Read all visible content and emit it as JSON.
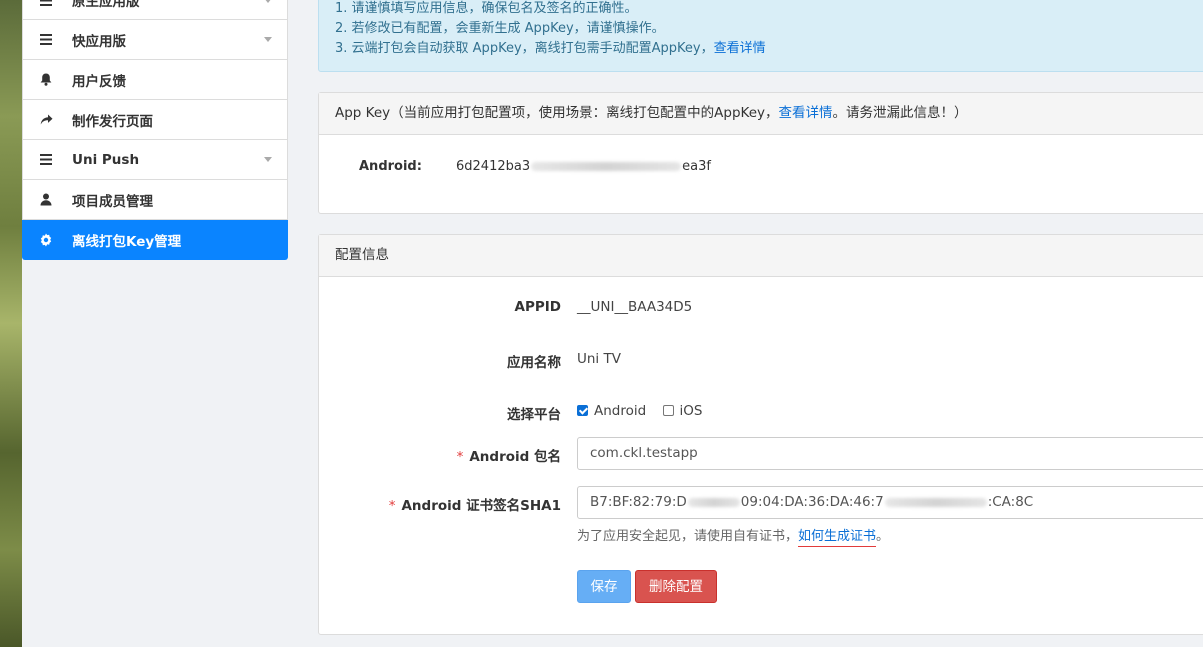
{
  "sidebar": {
    "items": [
      {
        "label": "原生应用版",
        "icon": "list-icon",
        "has_caret": true
      },
      {
        "label": "快应用版",
        "icon": "list-icon",
        "has_caret": true
      },
      {
        "label": "用户反馈",
        "icon": "bell-icon",
        "has_caret": false
      },
      {
        "label": "制作发行页面",
        "icon": "share-arrow-icon",
        "has_caret": false
      },
      {
        "label": "Uni Push",
        "icon": "list-icon",
        "has_caret": true
      },
      {
        "label": "项目成员管理",
        "icon": "user-icon",
        "has_caret": false
      },
      {
        "label": "离线打包Key管理",
        "icon": "gear-icon",
        "has_caret": false,
        "active": true
      }
    ]
  },
  "notice": {
    "line1": "1. 请谨慎填写应用信息，确保包名及签名的正确性。",
    "line2": "2. 若修改已有配置，会重新生成 AppKey，请谨慎操作。",
    "line3_text": "3. 云端打包会自动获取 AppKey，离线打包需手动配置AppKey，",
    "line3_link": "查看详情"
  },
  "appkey_panel": {
    "title_before": "App Key（当前应用打包配置项，使用场景：离线打包配置中的AppKey，",
    "title_link": "查看详情",
    "title_after": "。请务泄漏此信息！）",
    "android_label": "Android:",
    "android_key_start": "6d2412ba3",
    "android_key_end": "ea3f"
  },
  "config_panel": {
    "title": "配置信息",
    "appid_label": "APPID",
    "appid_value": "__UNI__BAA34D5",
    "appname_label": "应用名称",
    "appname_value": "Uni TV",
    "platform_label": "选择平台",
    "platform_android": "Android",
    "platform_ios": "iOS",
    "android_checked": true,
    "ios_checked": false,
    "package_label": "Android 包名",
    "package_value": "com.ckl.testapp",
    "sha1_label": "Android 证书签名SHA1",
    "sha1_value_start": "B7:BF:82:79:D",
    "sha1_value_mid": "09:04:DA:36:DA:46:7",
    "sha1_value_end": ":CA:8C",
    "required_mark": "*",
    "help_text": "为了应用安全起见，请使用自有证书，",
    "help_link": "如何生成证书",
    "help_end": "。",
    "save_label": "保存",
    "delete_label": "删除配置"
  },
  "colors": {
    "accent": "#0a84ff",
    "danger": "#d9534f",
    "save": "#66aef5",
    "notice_bg": "#d9eef7"
  }
}
